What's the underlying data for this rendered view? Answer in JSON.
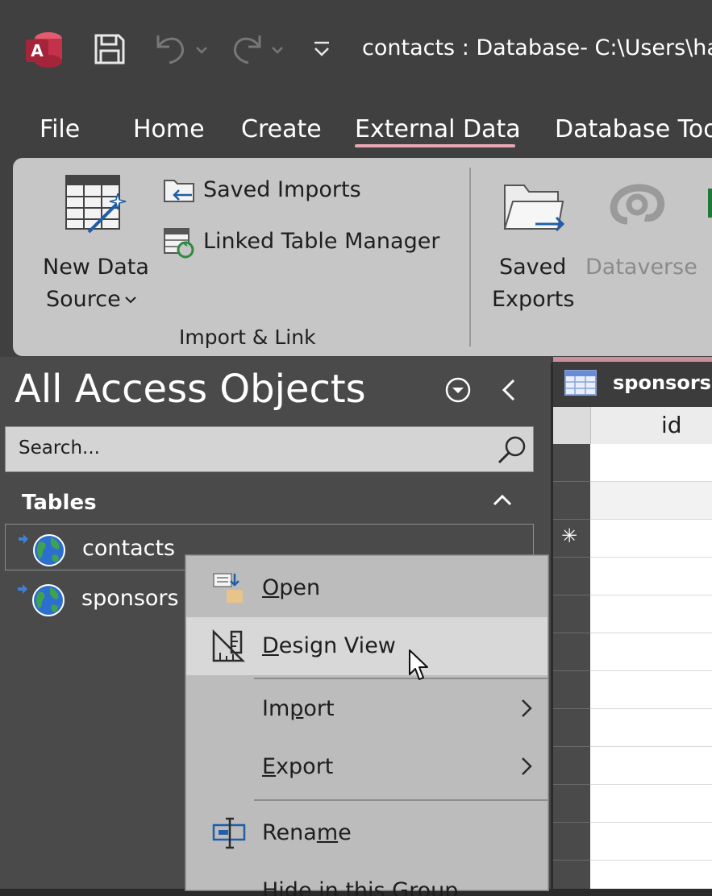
{
  "titlebar": {
    "title": "contacts : Database- C:\\Users\\hay",
    "icons": [
      "access-app-icon",
      "save-icon",
      "undo-icon",
      "redo-icon",
      "customize-qat-icon"
    ]
  },
  "tabs": [
    {
      "label": "File"
    },
    {
      "label": "Home"
    },
    {
      "label": "Create"
    },
    {
      "label": "External Data",
      "active": true
    },
    {
      "label": "Database Too"
    }
  ],
  "ribbon": {
    "new_data_source_line1": "New Data",
    "new_data_source_line2": "Source",
    "saved_imports": "Saved Imports",
    "linked_table_manager": "Linked Table Manager",
    "group_import_link": "Import & Link",
    "saved_exports_line1": "Saved",
    "saved_exports_line2": "Exports",
    "dataverse": "Dataverse"
  },
  "nav": {
    "title": "All Access Objects",
    "search_placeholder": "Search...",
    "tables_header": "Tables",
    "items": [
      {
        "label": "contacts",
        "selected": true
      },
      {
        "label": "sponsors",
        "selected": false
      }
    ]
  },
  "datasheet": {
    "tab_label": "sponsors",
    "column_header": "id",
    "new_record_marker": "✳"
  },
  "context_menu": {
    "items": [
      {
        "label_pre": "",
        "label_ul": "O",
        "label_post": "pen"
      },
      {
        "label_pre": "",
        "label_ul": "D",
        "label_post": "esign View",
        "hover": true
      },
      {
        "label_pre": "Im",
        "label_ul": "p",
        "label_post": "ort",
        "submenu": true
      },
      {
        "label_pre": "",
        "label_ul": "E",
        "label_post": "xport",
        "submenu": true
      },
      {
        "label_pre": "Rena",
        "label_ul": "m",
        "label_post": "e"
      },
      {
        "label_pre": "Hide in this Group",
        "label_ul": "",
        "label_post": ""
      }
    ]
  },
  "colors": {
    "accent_underline": "#e9a7b3",
    "access_red": "#c4314b",
    "ribbon_bg": "#c6c6c6",
    "menu_bg": "#bcbcbc"
  }
}
